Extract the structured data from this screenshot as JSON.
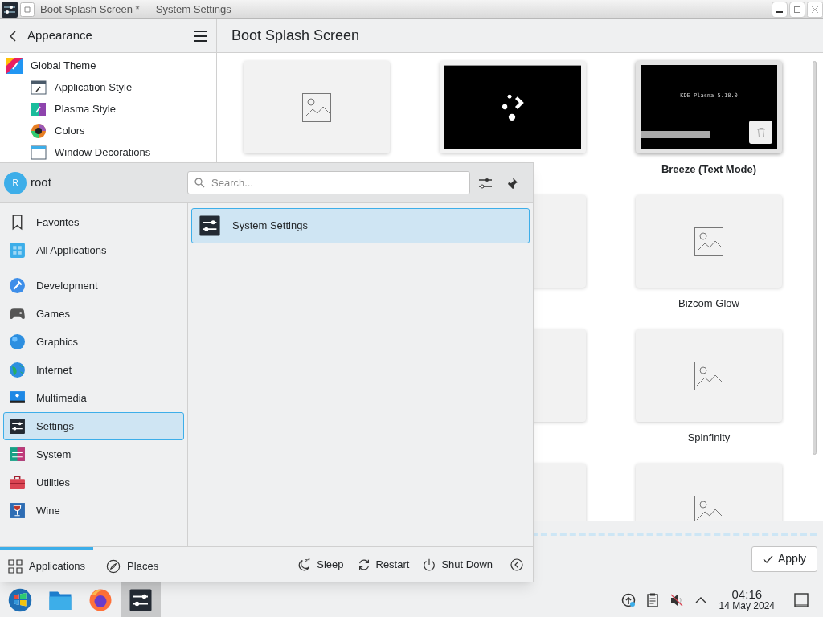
{
  "window": {
    "title": "Boot Splash Screen * — System Settings"
  },
  "sidebar": {
    "back_label": "Appearance",
    "items": [
      {
        "label": "Global Theme",
        "children": [
          {
            "label": "Application Style"
          },
          {
            "label": "Plasma Style"
          },
          {
            "label": "Colors"
          },
          {
            "label": "Window Decorations"
          }
        ]
      }
    ]
  },
  "page_title": "Boot Splash Screen",
  "theme_rows": [
    [
      {
        "kind": "placeholder",
        "selected": false
      },
      {
        "kind": "spinner",
        "selected": false
      },
      {
        "kind": "text",
        "preview_text": "KDE Plasma 5.18.0",
        "name": "Breeze (Text Mode)",
        "selected": true
      }
    ],
    [
      {
        "kind": "placeholder",
        "selected": false
      },
      {
        "kind": "placeholder",
        "name": "Bizcom Glow",
        "selected": false
      }
    ],
    [
      {
        "kind": "placeholder",
        "selected": false
      },
      {
        "kind": "placeholder",
        "name": "Spinfinity",
        "selected": false
      }
    ],
    [
      {
        "kind": "placeholder",
        "selected": false
      },
      {
        "kind": "placeholder",
        "selected": false
      }
    ]
  ],
  "apply_button": "Apply",
  "launcher": {
    "user_initial": "R",
    "user": "root",
    "search": {
      "placeholder": "Search..."
    },
    "categories": [
      {
        "label": "Favorites",
        "selected": false
      },
      {
        "label": "All Applications",
        "selected": false
      },
      {
        "label": "Development",
        "selected": false
      },
      {
        "label": "Games",
        "selected": false
      },
      {
        "label": "Graphics",
        "selected": false
      },
      {
        "label": "Internet",
        "selected": false
      },
      {
        "label": "Multimedia",
        "selected": false
      },
      {
        "label": "Settings",
        "selected": true
      },
      {
        "label": "System",
        "selected": false
      },
      {
        "label": "Utilities",
        "selected": false
      },
      {
        "label": "Wine",
        "selected": false
      }
    ],
    "apps": [
      {
        "label": "System Settings",
        "selected": true
      }
    ],
    "tabs": [
      {
        "label": "Applications",
        "selected": true
      },
      {
        "label": "Places",
        "selected": false
      }
    ],
    "power": [
      "Sleep",
      "Restart",
      "Shut Down"
    ]
  },
  "taskbar": {
    "tasks": [
      {
        "active": false
      },
      {
        "active": false
      },
      {
        "active": false
      },
      {
        "active": true
      }
    ],
    "time": "04:16",
    "date": "14 May 2024"
  }
}
